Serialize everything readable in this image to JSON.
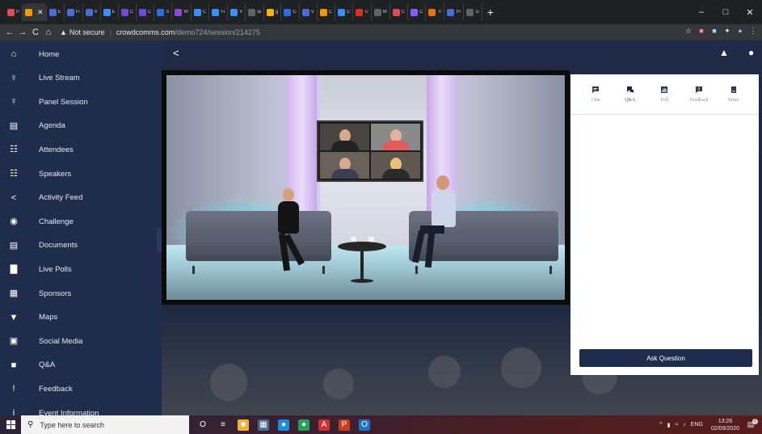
{
  "browser": {
    "tabs": [
      {
        "title": "P",
        "color": "#e04a5a"
      },
      {
        "title": "",
        "color": "#f29900",
        "active": true
      },
      {
        "title": "E",
        "color": "#4a6cd4"
      },
      {
        "title": "Fi",
        "color": "#4a6cd4"
      },
      {
        "title": "V",
        "color": "#4a6cd4"
      },
      {
        "title": "E",
        "color": "#3e8ef7"
      },
      {
        "title": "C",
        "color": "#6f4ad4"
      },
      {
        "title": "C",
        "color": "#6f4ad4"
      },
      {
        "title": "S",
        "color": "#2d6cdf"
      },
      {
        "title": "W",
        "color": "#8a4bd4"
      },
      {
        "title": "C",
        "color": "#3e8ef7"
      },
      {
        "title": "Fi",
        "color": "#3e8ef7"
      },
      {
        "title": "V",
        "color": "#3e8ef7"
      },
      {
        "title": "la",
        "color": "#5f6368"
      },
      {
        "title": "g",
        "color": "#f4b400"
      },
      {
        "title": "C",
        "color": "#2d6cdf"
      },
      {
        "title": "V",
        "color": "#4a6cd4"
      },
      {
        "title": "C",
        "color": "#f29900"
      },
      {
        "title": "C",
        "color": "#3e8ef7"
      },
      {
        "title": "U",
        "color": "#d93025"
      },
      {
        "title": "M",
        "color": "#5f6368"
      },
      {
        "title": "C",
        "color": "#e04a5a"
      },
      {
        "title": "C",
        "color": "#7b61ff"
      },
      {
        "title": "Tl",
        "color": "#e37400"
      },
      {
        "title": "Pr",
        "color": "#4a6cd4"
      },
      {
        "title": "D",
        "color": "#5f6368"
      }
    ],
    "new_tab": "+",
    "window_controls": [
      "–",
      "□",
      "✕"
    ],
    "nav": {
      "back": "←",
      "forward": "→",
      "reload": "C",
      "home": "⌂"
    },
    "address": {
      "warning_icon": "▲",
      "security_label": "Not secure",
      "separator": "|",
      "host": "crowdcomms.com",
      "path": "/demo724/session/214275"
    },
    "extensions": [
      "☆",
      "■",
      "■",
      "✦",
      "●",
      "⋮"
    ]
  },
  "sidebar": {
    "items": [
      {
        "label": "Home",
        "icon": "⌂"
      },
      {
        "label": "Live Stream",
        "icon": "☿"
      },
      {
        "label": "Panel Session",
        "icon": "☿"
      },
      {
        "label": "Agenda",
        "icon": "▤"
      },
      {
        "label": "Attendees",
        "icon": "☷"
      },
      {
        "label": "Speakers",
        "icon": "☷"
      },
      {
        "label": "Activity Feed",
        "icon": "<"
      },
      {
        "label": "Challenge",
        "icon": "◉"
      },
      {
        "label": "Documents",
        "icon": "▤"
      },
      {
        "label": "Live Polls",
        "icon": "▇"
      },
      {
        "label": "Sponsors",
        "icon": "▦"
      },
      {
        "label": "Maps",
        "icon": "▼"
      },
      {
        "label": "Social Media",
        "icon": "▣"
      },
      {
        "label": "Q&A",
        "icon": "■"
      },
      {
        "label": "Feedback",
        "icon": "!"
      },
      {
        "label": "Event Information",
        "icon": "i"
      }
    ]
  },
  "header": {
    "back_icon": "<",
    "bell_icon": "▲",
    "user_icon": "●"
  },
  "panel": {
    "tabs": [
      {
        "label": "Chat",
        "icon": "chat"
      },
      {
        "label": "Q&A",
        "icon": "qa",
        "active": true
      },
      {
        "label": "Poll",
        "icon": "poll"
      },
      {
        "label": "Feedback",
        "icon": "feedback"
      },
      {
        "label": "Notes",
        "icon": "notes"
      }
    ],
    "ask_button": "Ask Question"
  },
  "taskbar": {
    "search_placeholder": "Type here to search",
    "apps": [
      {
        "glyph": "O",
        "color": "transparent"
      },
      {
        "glyph": "≡",
        "color": "transparent"
      },
      {
        "glyph": "■",
        "color": "#f2b134"
      },
      {
        "glyph": "▦",
        "color": "#4c6a8a"
      },
      {
        "glyph": "●",
        "color": "#1b8be0"
      },
      {
        "glyph": "●",
        "color": "#22a35a"
      },
      {
        "glyph": "A",
        "color": "#d32f2f"
      },
      {
        "glyph": "P",
        "color": "#c43e1c"
      },
      {
        "glyph": "O",
        "color": "#1a73c8"
      }
    ],
    "tray": {
      "chevron": "^",
      "lang": "ENG",
      "time": "13:26",
      "date": "02/09/2020",
      "notifications": "2"
    }
  },
  "colors": {
    "sidebar_bg": "#1f2c4c",
    "accent": "#1e2b4d",
    "panel_bg": "#ffffff"
  }
}
